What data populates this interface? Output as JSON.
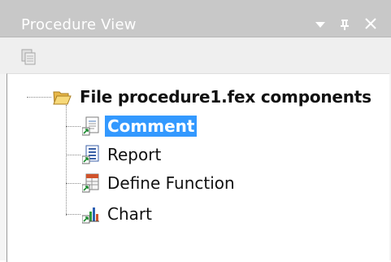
{
  "panel": {
    "title": "Procedure View",
    "title_bar_buttons": [
      {
        "name": "dropdown",
        "glyph": "▼"
      },
      {
        "name": "pin",
        "glyph": "ф"
      },
      {
        "name": "close",
        "glyph": "✕"
      }
    ]
  },
  "toolbar": {
    "items": [
      {
        "icon": "tree-view-icon"
      }
    ]
  },
  "tree": {
    "root": {
      "label": "File procedure1.fex components",
      "icon": "folder-open-icon"
    },
    "children": [
      {
        "label": "Comment",
        "icon": "comment-icon",
        "selected": true
      },
      {
        "label": "Report",
        "icon": "report-icon",
        "selected": false
      },
      {
        "label": "Define Function",
        "icon": "define-function-icon",
        "selected": false
      },
      {
        "label": "Chart",
        "icon": "chart-icon",
        "selected": false
      }
    ]
  },
  "colors": {
    "titlebar": "#c8c8c8",
    "selection": "#3399ff"
  }
}
